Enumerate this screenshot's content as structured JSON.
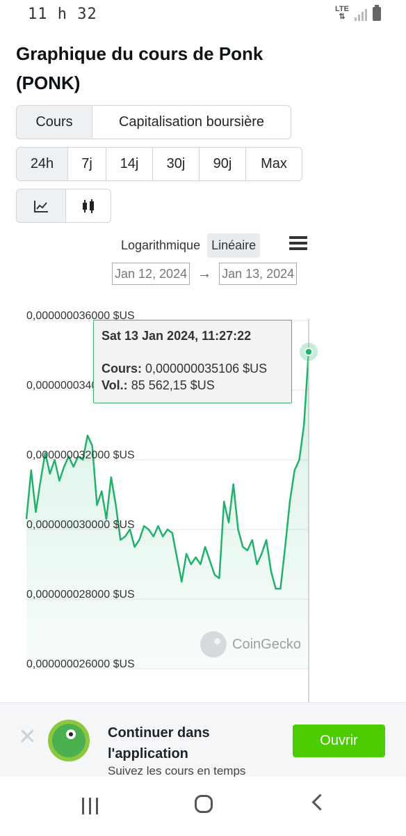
{
  "status": {
    "time": "11 h 32",
    "network": "LTE"
  },
  "page": {
    "title": "Graphique du cours de Ponk (PONK)"
  },
  "tabs": [
    "Cours",
    "Capitalisation boursière"
  ],
  "ranges": [
    "24h",
    "7j",
    "14j",
    "30j",
    "90j",
    "Max"
  ],
  "chart_types": [
    "line-chart-icon",
    "candlestick-icon"
  ],
  "scale": {
    "log_label": "Logarithmique",
    "linear_label": "Linéaire"
  },
  "dates": {
    "from": "Jan 12, 2024",
    "arrow": "→",
    "to": "Jan 13, 2024"
  },
  "tooltip": {
    "date": "Sat 13 Jan 2024, 11:27:22",
    "price_label": "Cours:",
    "price_value": "0,000000035106 $US",
    "vol_label": "Vol.:",
    "vol_value": "85 562,15 $US"
  },
  "watermark": "CoinGecko",
  "banner": {
    "title": "Continuer dans l'application",
    "subtitle": "Suivez les cours en temps",
    "open_label": "Ouvrir"
  },
  "colors": {
    "line": "#20b26c",
    "accent_button": "#4bcc00",
    "tooltip_border": "#3cb371"
  },
  "chart_data": {
    "type": "area",
    "title": "",
    "xlabel": "",
    "ylabel": "",
    "x_range": [
      "Jan 12, 2024",
      "Jan 13, 2024"
    ],
    "ylim": [
      2.6e-08,
      3.6e-08
    ],
    "yticks": [
      3.6e-08,
      3.4e-08,
      3.2e-08,
      3e-08,
      2.8e-08,
      2.6e-08
    ],
    "ytick_labels": [
      "0,000000036000 $US",
      "0,000000034000 $US",
      "0,000000032000 $US",
      "0,000000030000 $US",
      "0,000000028000 $US",
      "0,000000026000 $US"
    ],
    "grid": true,
    "scale": "linear",
    "values": [
      3.03e-08,
      3.17e-08,
      3.05e-08,
      3.14e-08,
      3.22e-08,
      3.16e-08,
      3.2e-08,
      3.14e-08,
      3.18e-08,
      3.21e-08,
      3.18e-08,
      3.21e-08,
      3.2e-08,
      3.27e-08,
      3.24e-08,
      3.07e-08,
      3.11e-08,
      3.03e-08,
      3.15e-08,
      3.07e-08,
      2.97e-08,
      2.98e-08,
      3e-08,
      2.95e-08,
      2.97e-08,
      3.01e-08,
      3e-08,
      2.98e-08,
      3.01e-08,
      2.98e-08,
      3e-08,
      2.99e-08,
      2.92e-08,
      2.85e-08,
      2.93e-08,
      2.9e-08,
      2.92e-08,
      2.9e-08,
      2.95e-08,
      2.91e-08,
      2.87e-08,
      2.86e-08,
      3.08e-08,
      3.02e-08,
      3.13e-08,
      3e-08,
      2.95e-08,
      2.94e-08,
      2.97e-08,
      2.9e-08,
      2.93e-08,
      2.97e-08,
      2.88e-08,
      2.83e-08,
      2.83e-08,
      2.95e-08,
      3.08e-08,
      3.17e-08,
      3.2e-08,
      3.3e-08,
      3.51e-08
    ],
    "series": [
      {
        "values_ref": "values"
      }
    ],
    "highlight_index": 60
  }
}
